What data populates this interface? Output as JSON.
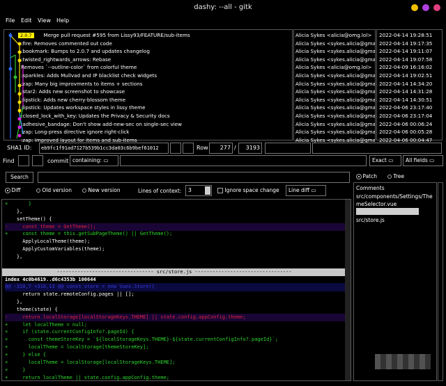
{
  "window": {
    "title": "dashy: --all - gitk"
  },
  "menu": {
    "file": "File",
    "edit": "Edit",
    "view": "View",
    "help": "Help"
  },
  "commits": [
    {
      "tag": "2.0.7",
      "subject": "Merge pull request #595 from Lissy93/FEATURE/sub-items",
      "author": "Alicia Sykes <alicia@omg.lol>",
      "date": "2022-04-14 19:28:51"
    },
    {
      "subject": ":fire: Removes commented out code",
      "author": "Alicia Sykes <sykes.alicia@gma",
      "date": "2022-04-14 19:17:35"
    },
    {
      "subject": ":bookmark: Bumps to 2.0.7 and updates changelog",
      "author": "Alicia Sykes <sykes.alicia@gma",
      "date": "2022-04-14 19:11:07"
    },
    {
      "subject": ":twisted_rightwards_arrows: Rebase",
      "author": "Alicia Sykes <sykes.alicia@gma",
      "date": "2022-04-14 19:07:58"
    },
    {
      "subject": "Removes `--outline-color` from colorful theme",
      "author": "Alicia Sykes <alicia@omg.lol>",
      "date": "2022-04-09 16:16:02"
    },
    {
      "subject": ":sparkles: Adds Mullvad and IP blacklist check widgets",
      "author": "Alicia Sykes <sykes.alicia@gma",
      "date": "2022-04-14 19:02:51"
    },
    {
      "subject": ":zap: Many big improvments to items + sections",
      "author": "Alicia Sykes <sykes.alicia@gma",
      "date": "2022-04-14 14:34:20"
    },
    {
      "subject": ":star2: Adds new screenshot to showcase",
      "author": "Alicia Sykes <sykes.alicia@gma",
      "date": "2022-04-14 14:31:28"
    },
    {
      "subject": ":lipstick: Adds new cherry-blossom theme",
      "author": "Alicia Sykes <sykes.alicia@gma",
      "date": "2022-04-14 14:30:51"
    },
    {
      "subject": ":lipstick: Updates workspace styles in lissy theme",
      "author": "Alicia Sykes <sykes.alicia@gma",
      "date": "2022-04-06 23:17:40"
    },
    {
      "subject": ":closed_lock_with_key: Updates the Privacy & Security docs",
      "author": "Alicia Sykes <sykes.alicia@gma",
      "date": "2022-04-06 23:17:04"
    },
    {
      "subject": ":adhesive_bandage: Don't show add-new-sec on single-sec view",
      "author": "Alicia Sykes <sykes.alicia@gma",
      "date": "2022-04-06 00:06:24"
    },
    {
      "subject": ":zap: Long-press directive ignore right-click",
      "author": "Alicia Sykes <sykes.alicia@gma",
      "date": "2022-04-06 00:05:28"
    },
    {
      "subject": ":zap: Improved layout for items and sub-items",
      "author": "Alicia Sykes <sykes.alicia@gma",
      "date": "2022-04-06 00:04:47"
    }
  ],
  "sha": {
    "label": "SHA1 ID:",
    "value": "eb9fc1f91ad7127b539b1cc3da03c6b9bef61012",
    "row_label": "Row",
    "row_value": "277",
    "row_sep": "/",
    "row_total": "3193"
  },
  "find": {
    "label": "Find",
    "commit_label": "commit",
    "containing": "containing:",
    "exact": "Exact",
    "all_fields": "All fields"
  },
  "search": {
    "button": "Search"
  },
  "options": {
    "diff": "Diff",
    "old_version": "Old version",
    "new_version": "New version",
    "context_label": "Lines of context:",
    "context_value": "3",
    "ignore_space": "Ignore space change",
    "line_diff": "Line diff"
  },
  "right_panel": {
    "patch": "Patch",
    "tree": "Tree",
    "files": [
      "Comments",
      "src/components/Settings/ThemeSelector.vue",
      "src/store.js"
    ]
  },
  "diff_lines": [
    {
      "t": "+       }",
      "k": "add"
    },
    {
      "t": "    },",
      "k": "ctx"
    },
    {
      "t": "    setTheme() {",
      "k": "ctx"
    },
    {
      "t": "-     const theme = GetTheme();",
      "k": "del"
    },
    {
      "t": "+     const theme = this.getSubPageTheme() || GetTheme();",
      "k": "add"
    },
    {
      "t": "      ApplyLocalTheme(theme);",
      "k": "ctx"
    },
    {
      "t": "      ApplyCustomVariables(theme);",
      "k": "ctx"
    },
    {
      "t": "    },",
      "k": "ctx"
    },
    {
      "t": "",
      "k": "ctx"
    },
    {
      "t": "--------------------------------- src/store.js ---------------------------------",
      "k": "file"
    },
    {
      "t": "index 4c0b4619..d6c4353b 100644",
      "k": "index"
    },
    {
      "t": "@@ -310,7 +310,13 @@ const store = new Vuex.Store({",
      "k": "hunk"
    },
    {
      "t": "      return state.remoteConfig.pages || [];",
      "k": "ctx"
    },
    {
      "t": "    },",
      "k": "ctx"
    },
    {
      "t": "    theme(state) {",
      "k": "ctx"
    },
    {
      "t": "-     return localStorage[localStorageKeys.THEME] || state.config.appConfig.theme;",
      "k": "del"
    },
    {
      "t": "+     let localTheme = null;",
      "k": "add"
    },
    {
      "t": "+     if (state.currentConfigInfo?.pageId) {",
      "k": "add"
    },
    {
      "t": "+       const themeStoreKey = `${localStorageKeys.THEME}-${state.currentConfigInfo?.pageId}`;",
      "k": "add"
    },
    {
      "t": "+       localTheme = localStorage[themeStoreKey];",
      "k": "add"
    },
    {
      "t": "+     } else {",
      "k": "add"
    },
    {
      "t": "+       localTheme = localStorage[localStorageKeys.THEME];",
      "k": "add"
    },
    {
      "t": "+     }",
      "k": "add"
    },
    {
      "t": "+     return localTheme || state.config.appConfig.theme;",
      "k": "add"
    }
  ],
  "colors": {
    "add": "#2fd62f",
    "del": "#e0203a",
    "ctx": "#ffffff",
    "hunk": "#3a3ad8",
    "file_bg": "#c8c8c8",
    "del_bg": "#1a0636",
    "tag": "#ffee00"
  }
}
